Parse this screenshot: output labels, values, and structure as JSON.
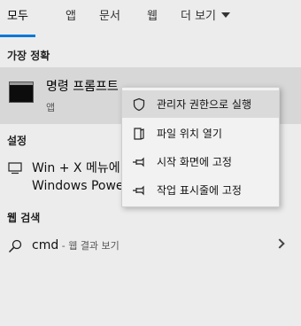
{
  "tabs": [
    {
      "label": "모두",
      "active": true
    },
    {
      "label": "앱"
    },
    {
      "label": "문서"
    },
    {
      "label": "웹"
    },
    {
      "label": "더 보기"
    }
  ],
  "best_match": {
    "heading": "가장 정확",
    "app_name": "명령 프롬프트",
    "app_type": "앱",
    "icon": "command-prompt-icon"
  },
  "settings": {
    "heading": "설정",
    "item_line1": "Win + X 메뉴에",
    "item_line2": "Windows PowerShell",
    "icon": "monitor-icon"
  },
  "web_search": {
    "heading": "웹 검색",
    "query": "cmd",
    "suffix": " - 웹 결과 보기",
    "icon": "search-icon"
  },
  "context_menu": {
    "items": [
      {
        "label": "관리자 권한으로 실행",
        "icon": "shield-icon",
        "hovered": true
      },
      {
        "label": "파일 위치 열기",
        "icon": "folder-open-icon"
      },
      {
        "label": "시작 화면에 고정",
        "icon": "pin-icon"
      },
      {
        "label": "작업 표시줄에 고정",
        "icon": "pin-icon"
      }
    ]
  },
  "colors": {
    "accent": "#0078d7",
    "background": "#ececec",
    "selected": "#d7d7d7"
  }
}
